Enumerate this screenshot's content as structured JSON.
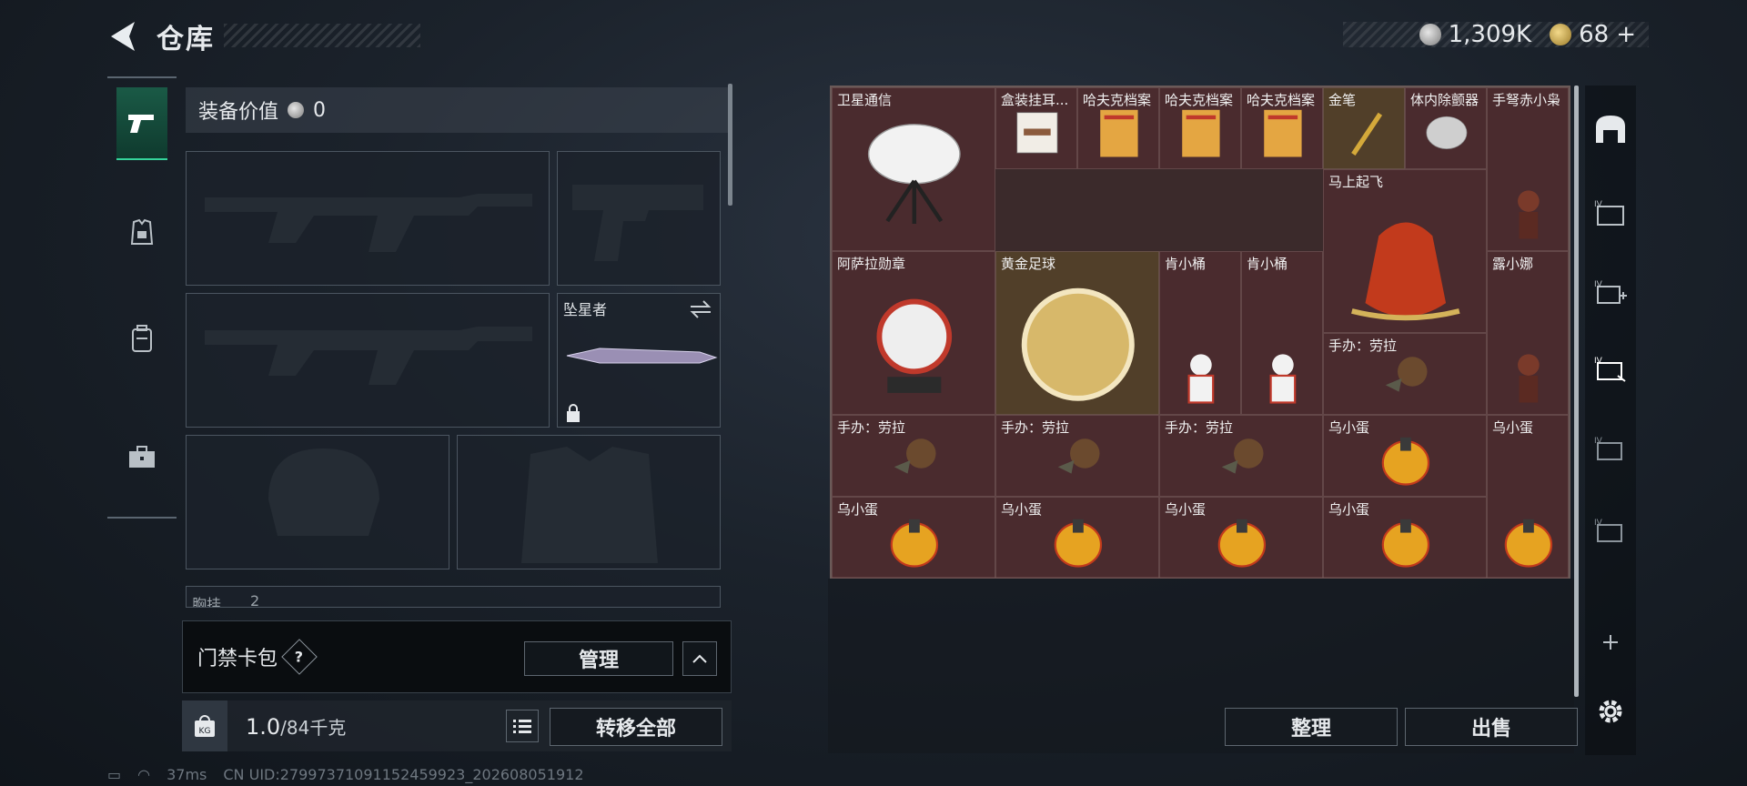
{
  "header": {
    "title": "仓库"
  },
  "currency": {
    "silver": "1,309K",
    "gold": "68",
    "gold_suffix": "+"
  },
  "equip": {
    "value_label": "装备价值",
    "value": "0",
    "melee_name": "坠星者",
    "chest_partial": "胸挂",
    "chest_count": "2"
  },
  "access": {
    "label": "门禁卡包",
    "help": "?",
    "manage": "管理"
  },
  "weight": {
    "value": "1.0",
    "capacity": "/84千克",
    "transfer_all": "转移全部"
  },
  "stash": {
    "items": [
      {
        "name": "卫星通信",
        "icon": "satellite-dish"
      },
      {
        "name": "盒装挂耳...",
        "icon": "coffee-box"
      },
      {
        "name": "哈夫克档案",
        "icon": "file-folder"
      },
      {
        "name": "哈夫克档案",
        "icon": "file-folder"
      },
      {
        "name": "哈夫克档案",
        "icon": "file-folder"
      },
      {
        "name": "金笔",
        "icon": "gold-pen"
      },
      {
        "name": "体内除颤器",
        "icon": "defibrillator"
      },
      {
        "name": "手弩赤小枭",
        "icon": "figure"
      },
      {
        "name": "马上起飞",
        "icon": "rocking-horse"
      },
      {
        "name": "阿萨拉勋章",
        "icon": "medal"
      },
      {
        "name": "黄金足球",
        "icon": "golden-ball"
      },
      {
        "name": "肯小桶",
        "icon": "kfc-figure"
      },
      {
        "name": "肯小桶",
        "icon": "kfc-figure"
      },
      {
        "name": "露小娜",
        "icon": "figure"
      },
      {
        "name": "手办：劳拉",
        "icon": "lara-figure"
      },
      {
        "name": "手办：劳拉",
        "icon": "lara-figure"
      },
      {
        "name": "手办：劳拉",
        "icon": "lara-figure"
      },
      {
        "name": "手办：劳拉",
        "icon": "lara-figure"
      },
      {
        "name": "乌小蛋",
        "icon": "egg"
      },
      {
        "name": "乌小蛋",
        "icon": "egg"
      },
      {
        "name": "乌小蛋",
        "icon": "egg"
      },
      {
        "name": "乌小蛋",
        "icon": "egg"
      },
      {
        "name": "乌小蛋",
        "icon": "egg"
      },
      {
        "name": "乌小蛋",
        "icon": "egg"
      }
    ]
  },
  "actions": {
    "sort": "整理",
    "sell": "出售"
  },
  "status": {
    "ping": "37ms",
    "uid": "CN UID:27997371091152459923_202608051912"
  },
  "colors": {
    "accent": "#35d49b",
    "slot_bg": "#582c32"
  }
}
